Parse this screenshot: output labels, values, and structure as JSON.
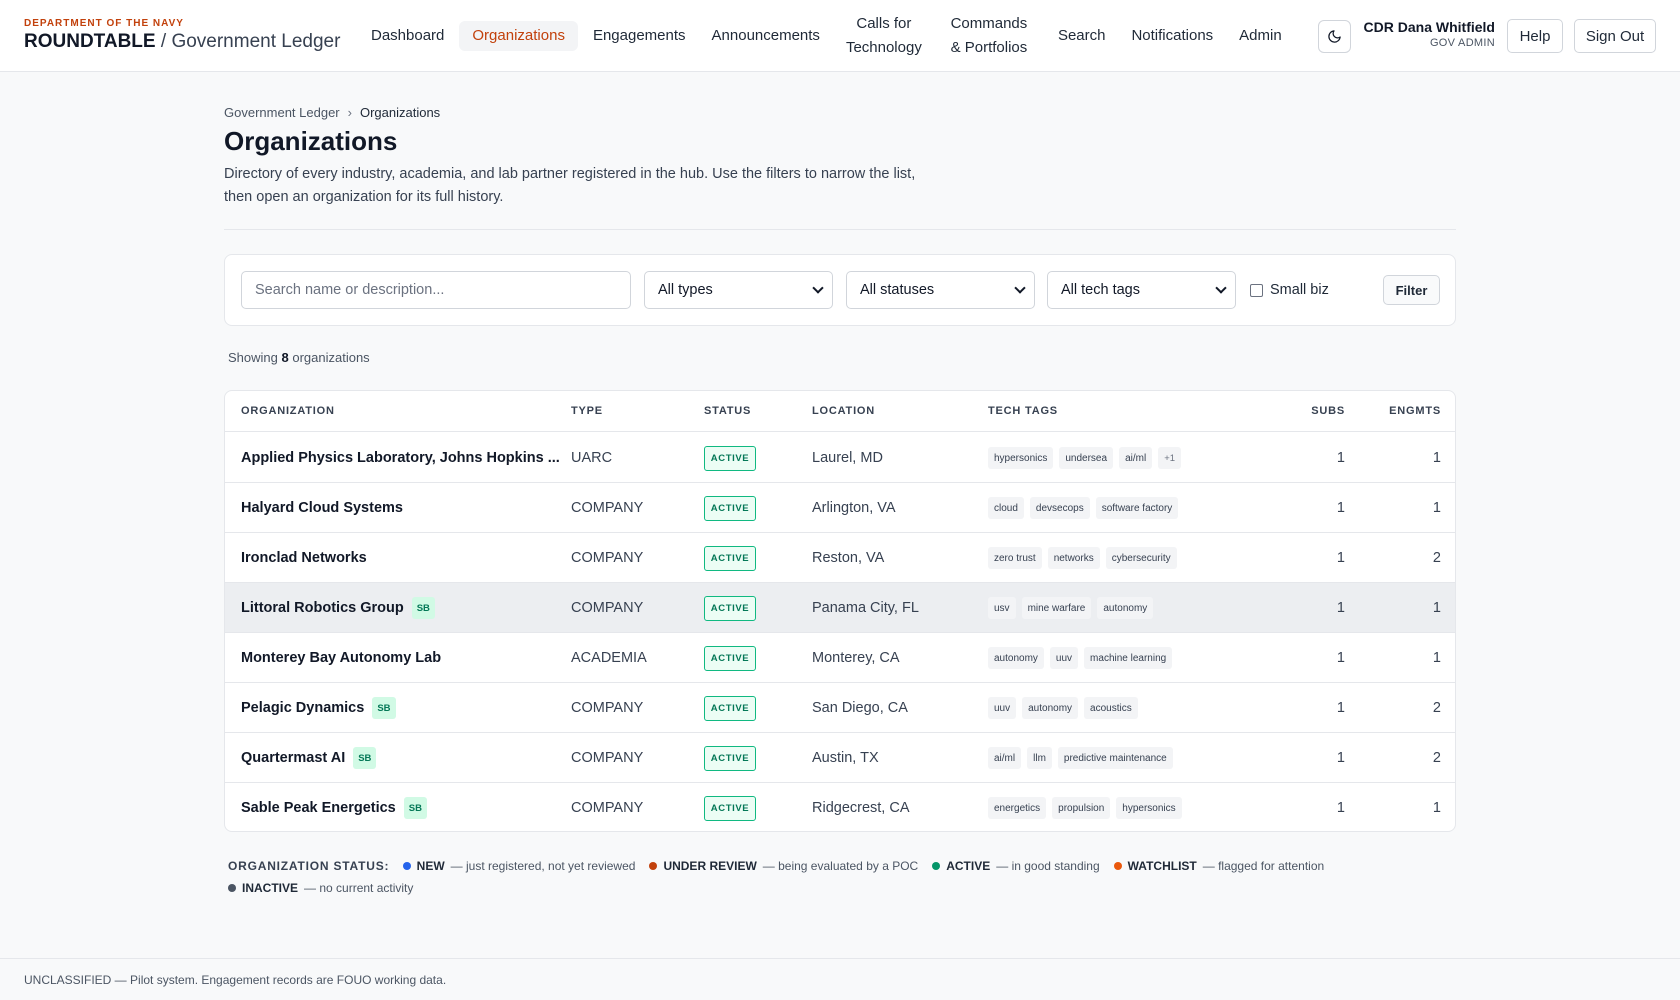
{
  "brand": {
    "dept": "DEPARTMENT OF THE NAVY",
    "name": "ROUNDTABLE",
    "sep": " / ",
    "sub": "Government Ledger"
  },
  "nav": [
    "Dashboard",
    "Organizations",
    "Engagements",
    "Announcements",
    "Calls for Technology",
    "Commands & Portfolios",
    "Search",
    "Notifications",
    "Admin"
  ],
  "user": {
    "name": "CDR Dana Whitfield",
    "role": "GOV ADMIN"
  },
  "header_buttons": {
    "help": "Help",
    "sign_out": "Sign Out"
  },
  "breadcrumb": {
    "root": "Government Ledger",
    "current": "Organizations"
  },
  "page": {
    "title": "Organizations",
    "description": "Directory of every industry, academia, and lab partner registered in the hub. Use the filters to narrow the list, then open an organization for its full history."
  },
  "filters": {
    "search_placeholder": "Search name or description...",
    "type": "All types",
    "status": "All statuses",
    "tags": "All tech tags",
    "small_biz": "Small biz",
    "filter_btn": "Filter"
  },
  "showing": {
    "prefix": "Showing",
    "count": "8",
    "suffix": "organizations"
  },
  "table": {
    "headers": [
      "ORGANIZATION",
      "TYPE",
      "STATUS",
      "LOCATION",
      "TECH TAGS",
      "SUBS",
      "ENGMTS"
    ],
    "rows": [
      {
        "name": "Applied Physics Laboratory, Johns Hopkins ...",
        "sb": "",
        "type": "UARC",
        "status": "ACTIVE",
        "location": "Laurel, MD",
        "tags": [
          "hypersonics",
          "undersea",
          "ai/ml"
        ],
        "more": "+1",
        "subs": "1",
        "engmts": "1"
      },
      {
        "name": "Halyard Cloud Systems",
        "sb": "",
        "type": "COMPANY",
        "status": "ACTIVE",
        "location": "Arlington, VA",
        "tags": [
          "cloud",
          "devsecops",
          "software factory"
        ],
        "more": "",
        "subs": "1",
        "engmts": "1"
      },
      {
        "name": "Ironclad Networks",
        "sb": "",
        "type": "COMPANY",
        "status": "ACTIVE",
        "location": "Reston, VA",
        "tags": [
          "zero trust",
          "networks",
          "cybersecurity"
        ],
        "more": "",
        "subs": "1",
        "engmts": "2"
      },
      {
        "name": "Littoral Robotics Group",
        "sb": "SB",
        "type": "COMPANY",
        "status": "ACTIVE",
        "location": "Panama City, FL",
        "tags": [
          "usv",
          "mine warfare",
          "autonomy"
        ],
        "more": "",
        "subs": "1",
        "engmts": "1"
      },
      {
        "name": "Monterey Bay Autonomy Lab",
        "sb": "",
        "type": "ACADEMIA",
        "status": "ACTIVE",
        "location": "Monterey, CA",
        "tags": [
          "autonomy",
          "uuv",
          "machine learning"
        ],
        "more": "",
        "subs": "1",
        "engmts": "1"
      },
      {
        "name": "Pelagic Dynamics",
        "sb": "SB",
        "type": "COMPANY",
        "status": "ACTIVE",
        "location": "San Diego, CA",
        "tags": [
          "uuv",
          "autonomy",
          "acoustics"
        ],
        "more": "",
        "subs": "1",
        "engmts": "2"
      },
      {
        "name": "Quartermast AI",
        "sb": "SB",
        "type": "COMPANY",
        "status": "ACTIVE",
        "location": "Austin, TX",
        "tags": [
          "ai/ml",
          "llm",
          "predictive maintenance"
        ],
        "more": "",
        "subs": "1",
        "engmts": "2"
      },
      {
        "name": "Sable Peak Energetics",
        "sb": "SB",
        "type": "COMPANY",
        "status": "ACTIVE",
        "location": "Ridgecrest, CA",
        "tags": [
          "energetics",
          "propulsion",
          "hypersonics"
        ],
        "more": "",
        "subs": "1",
        "engmts": "1"
      }
    ]
  },
  "legend": {
    "title": "ORGANIZATION STATUS:",
    "items": [
      {
        "label": "NEW",
        "desc": "— just registered, not yet reviewed",
        "color": "#2563eb"
      },
      {
        "label": "UNDER REVIEW",
        "desc": "— being evaluated by a POC",
        "color": "#c2410c"
      },
      {
        "label": "ACTIVE",
        "desc": "— in good standing",
        "color": "#059669"
      },
      {
        "label": "WATCHLIST",
        "desc": "— flagged for attention",
        "color": "#ea580c"
      },
      {
        "label": "INACTIVE",
        "desc": "— no current activity",
        "color": "#4b5563"
      }
    ]
  },
  "footer": "UNCLASSIFIED — Pilot system. Engagement records are FOUO working data."
}
